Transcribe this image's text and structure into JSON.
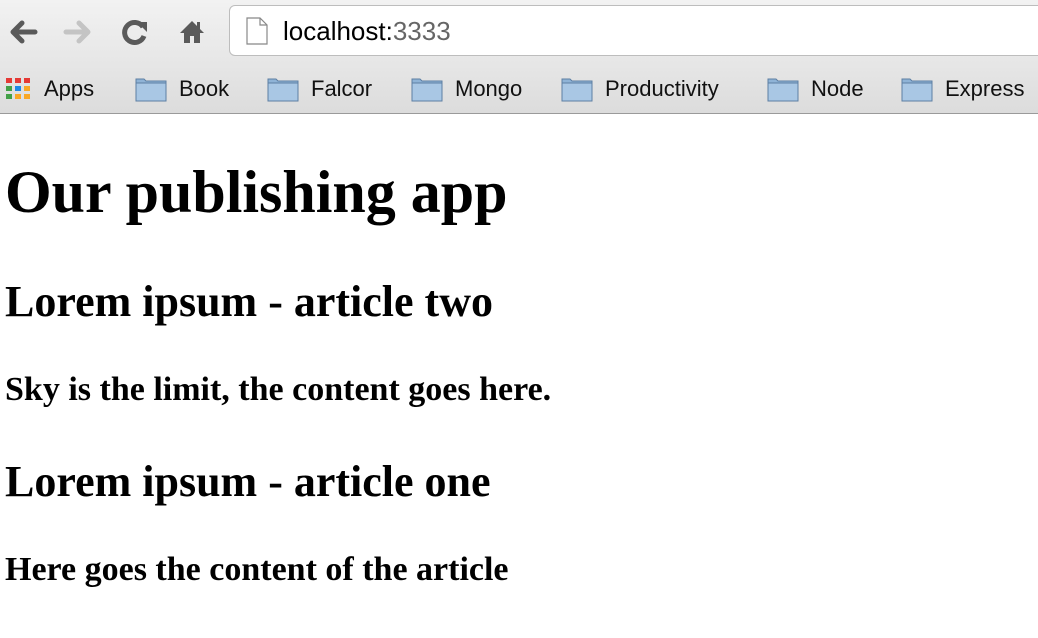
{
  "browser": {
    "url_host": "localhost:",
    "url_port": "3333",
    "bookmarks": [
      {
        "label": "Apps",
        "icon": "apps-grid-icon"
      },
      {
        "label": "Book",
        "icon": "folder-icon"
      },
      {
        "label": "Falcor",
        "icon": "folder-icon"
      },
      {
        "label": "Mongo",
        "icon": "folder-icon"
      },
      {
        "label": "Productivity",
        "icon": "folder-icon"
      },
      {
        "label": "Node",
        "icon": "folder-icon"
      },
      {
        "label": "Express",
        "icon": "folder-icon"
      }
    ]
  },
  "page": {
    "title": "Our publishing app",
    "articles": [
      {
        "title": "Lorem ipsum - article two",
        "content": "Sky is the limit, the content goes here."
      },
      {
        "title": "Lorem ipsum - article one",
        "content": "Here goes the content of the article"
      }
    ]
  }
}
